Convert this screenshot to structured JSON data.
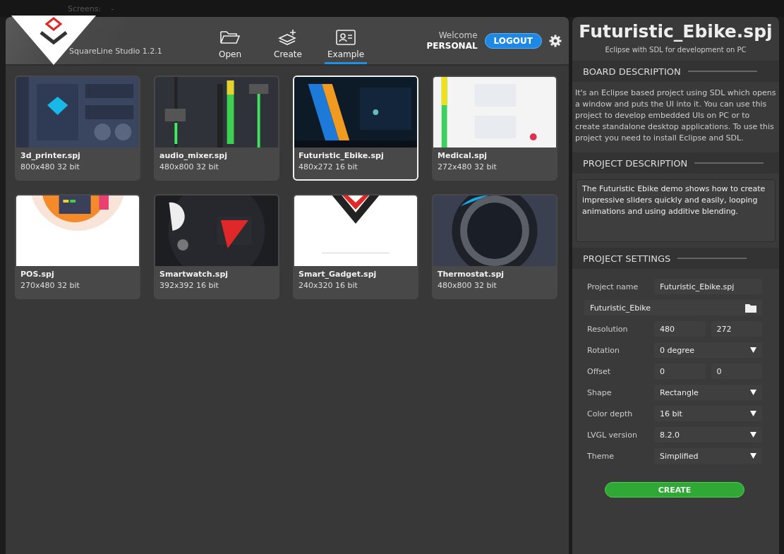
{
  "background_toolbar": {
    "label": "Screens:",
    "value": "-"
  },
  "header": {
    "app_name": "SquareLine Studio 1.2.1",
    "welcome": "Welcome",
    "user": "PERSONAL",
    "logout": "LOGOUT"
  },
  "nav": [
    {
      "label": "Open",
      "kind": "open",
      "selected": false
    },
    {
      "label": "Create",
      "kind": "create",
      "selected": false
    },
    {
      "label": "Example",
      "kind": "example",
      "selected": true
    }
  ],
  "projects": [
    {
      "name": "3d_printer.spj",
      "info": "800x480 32 bit",
      "selected": false
    },
    {
      "name": "audio_mixer.spj",
      "info": "480x800 32 bit",
      "selected": false
    },
    {
      "name": "Futuristic_Ebike.spj",
      "info": "480x272 16 bit",
      "selected": true
    },
    {
      "name": "Medical.spj",
      "info": "272x480 32 bit",
      "selected": false
    },
    {
      "name": "POS.spj",
      "info": "270x480 32 bit",
      "selected": false
    },
    {
      "name": "Smartwatch.spj",
      "info": "392x392 16 bit",
      "selected": false
    },
    {
      "name": "Smart_Gadget.spj",
      "info": "240x320 16 bit",
      "selected": false
    },
    {
      "name": "Thermostat.spj",
      "info": "480x800 32 bit",
      "selected": false
    }
  ],
  "details": {
    "title": "Futuristic_Ebike.spj",
    "subtitle": "Eclipse with SDL for development on PC",
    "board_heading": "BOARD DESCRIPTION",
    "board_text": "It's an Eclipse based project using SDL which opens a window and puts the UI into it. You can use this project to develop embedded UIs on PC or to create standalone desktop applications. To use this project you need to install Eclipse and SDL.",
    "project_heading": "PROJECT DESCRIPTION",
    "project_text": "The Futuristic Ebike demo shows how to create impressive sliders quickly and easily, looping animations and using additive blending.",
    "settings_heading": "PROJECT SETTINGS",
    "settings": [
      {
        "kind": "text",
        "label": "Project name",
        "value": "Futuristic_Ebike.spj"
      },
      {
        "kind": "path",
        "value": "Futuristic_Ebike"
      },
      {
        "kind": "pair",
        "label": "Resolution",
        "values": [
          "480",
          "272"
        ]
      },
      {
        "kind": "select",
        "label": "Rotation",
        "value": "0 degree"
      },
      {
        "kind": "pair",
        "label": "Offset",
        "values": [
          "0",
          "0"
        ]
      },
      {
        "kind": "select",
        "label": "Shape",
        "value": "Rectangle"
      },
      {
        "kind": "select",
        "label": "Color depth",
        "value": "16 bit"
      },
      {
        "kind": "select",
        "label": "LVGL version",
        "value": "8.2.0"
      },
      {
        "kind": "select",
        "label": "Theme",
        "value": "Simplified"
      }
    ],
    "create": "CREATE"
  }
}
